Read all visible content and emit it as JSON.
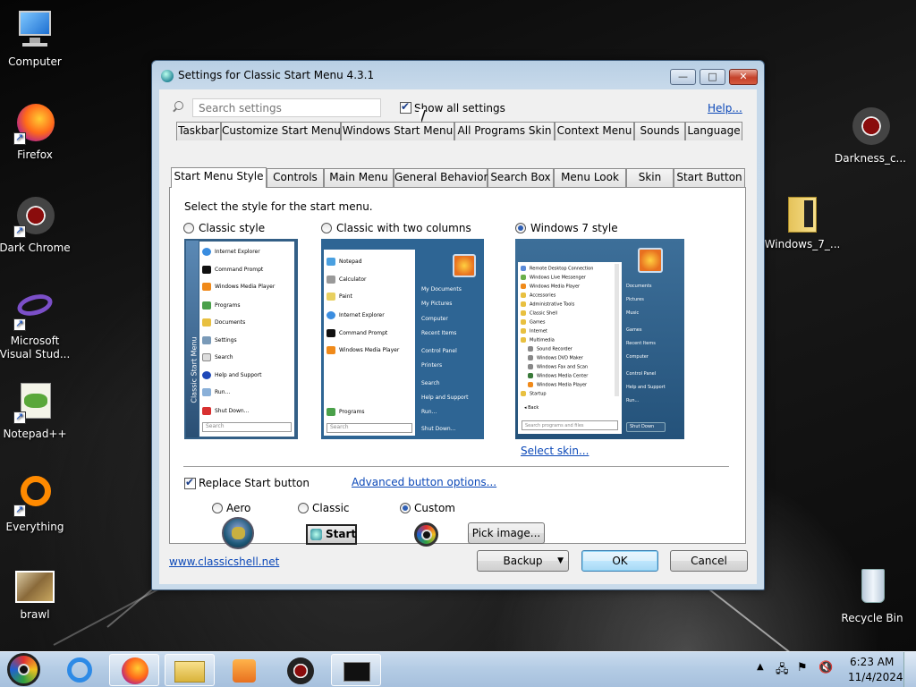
{
  "desktop": {
    "icons": [
      {
        "label": "Computer"
      },
      {
        "label": "Firefox"
      },
      {
        "label": "Dark Chrome"
      },
      {
        "label": "Microsoft Visual Stud..."
      },
      {
        "label": "Notepad++"
      },
      {
        "label": "Everything"
      },
      {
        "label": "brawl"
      },
      {
        "label": "Darkness_c..."
      },
      {
        "label": "Windows_7_..."
      },
      {
        "label": "Recycle Bin"
      }
    ]
  },
  "window": {
    "title": "Settings for Classic Start Menu 4.3.1",
    "minimize": "—",
    "maximize": "□",
    "close": "✕"
  },
  "toolbar": {
    "search_placeholder": "Search settings",
    "show_all_label": "Show all settings",
    "show_all_checked": true,
    "help_link": "Help..."
  },
  "tabs_row1": [
    "Taskbar",
    "Customize Start Menu",
    "Windows Start Menu",
    "All Programs Skin",
    "Context Menu",
    "Sounds",
    "Language"
  ],
  "tabs_row2": [
    "Start Menu Style",
    "Controls",
    "Main Menu",
    "General Behavior",
    "Search Box",
    "Menu Look",
    "Skin",
    "Start Button"
  ],
  "active_tab": "Start Menu Style",
  "style_panel": {
    "instruction": "Select the style for the start menu.",
    "options": [
      {
        "label": "Classic style",
        "selected": false
      },
      {
        "label": "Classic with two columns",
        "selected": false
      },
      {
        "label": "Windows 7 style",
        "selected": true
      }
    ],
    "select_skin_link": "Select skin...",
    "classic_preview": {
      "sidebar": "Classic Start Menu",
      "items": [
        "Internet Explorer",
        "Command Prompt",
        "Windows Media Player",
        "Programs",
        "Documents",
        "Settings",
        "Search",
        "Help and Support",
        "Run...",
        "Shut Down..."
      ],
      "search": "Search"
    },
    "twocol_preview": {
      "left_items": [
        "Notepad",
        "Calculator",
        "Paint",
        "Internet Explorer",
        "Command Prompt",
        "Windows Media Player",
        "Programs"
      ],
      "right_items": [
        "My Documents",
        "My Pictures",
        "Computer",
        "Recent Items",
        "Control Panel",
        "Printers",
        "Search",
        "Help and Support",
        "Run...",
        "Shut Down..."
      ],
      "search": "Search"
    },
    "win7_preview": {
      "left_items": [
        "Remote Desktop Connection",
        "Windows Live Messenger",
        "Windows Media Player",
        "Accessories",
        "Administrative Tools",
        "Classic Shell",
        "Games",
        "Internet",
        "Multimedia",
        "Sound Recorder",
        "Windows DVD Maker",
        "Windows Fax and Scan",
        "Windows Media Center",
        "Windows Media Player",
        "Startup",
        "Back"
      ],
      "right_items": [
        "Documents",
        "Pictures",
        "Music",
        "Games",
        "Recent Items",
        "Computer",
        "Control Panel",
        "Help and Support",
        "Run...",
        "Shut Down"
      ],
      "search": "Search programs and files"
    }
  },
  "button_panel": {
    "replace_label": "Replace Start button",
    "replace_checked": true,
    "advanced_link": "Advanced button options...",
    "aero_label": "Aero",
    "classic_label": "Classic",
    "custom_label": "Custom",
    "selected": "Custom",
    "start_label": "Start",
    "pick_image": "Pick image..."
  },
  "footer": {
    "website": "www.classicshell.net",
    "backup": "Backup",
    "ok": "OK",
    "cancel": "Cancel"
  },
  "taskbar": {
    "time": "6:23 AM",
    "date": "11/4/2024"
  },
  "colors": {
    "link": "#0b48b8",
    "win7_menu_blue": "#2a5c86",
    "accent_orange": "#e8701f"
  }
}
